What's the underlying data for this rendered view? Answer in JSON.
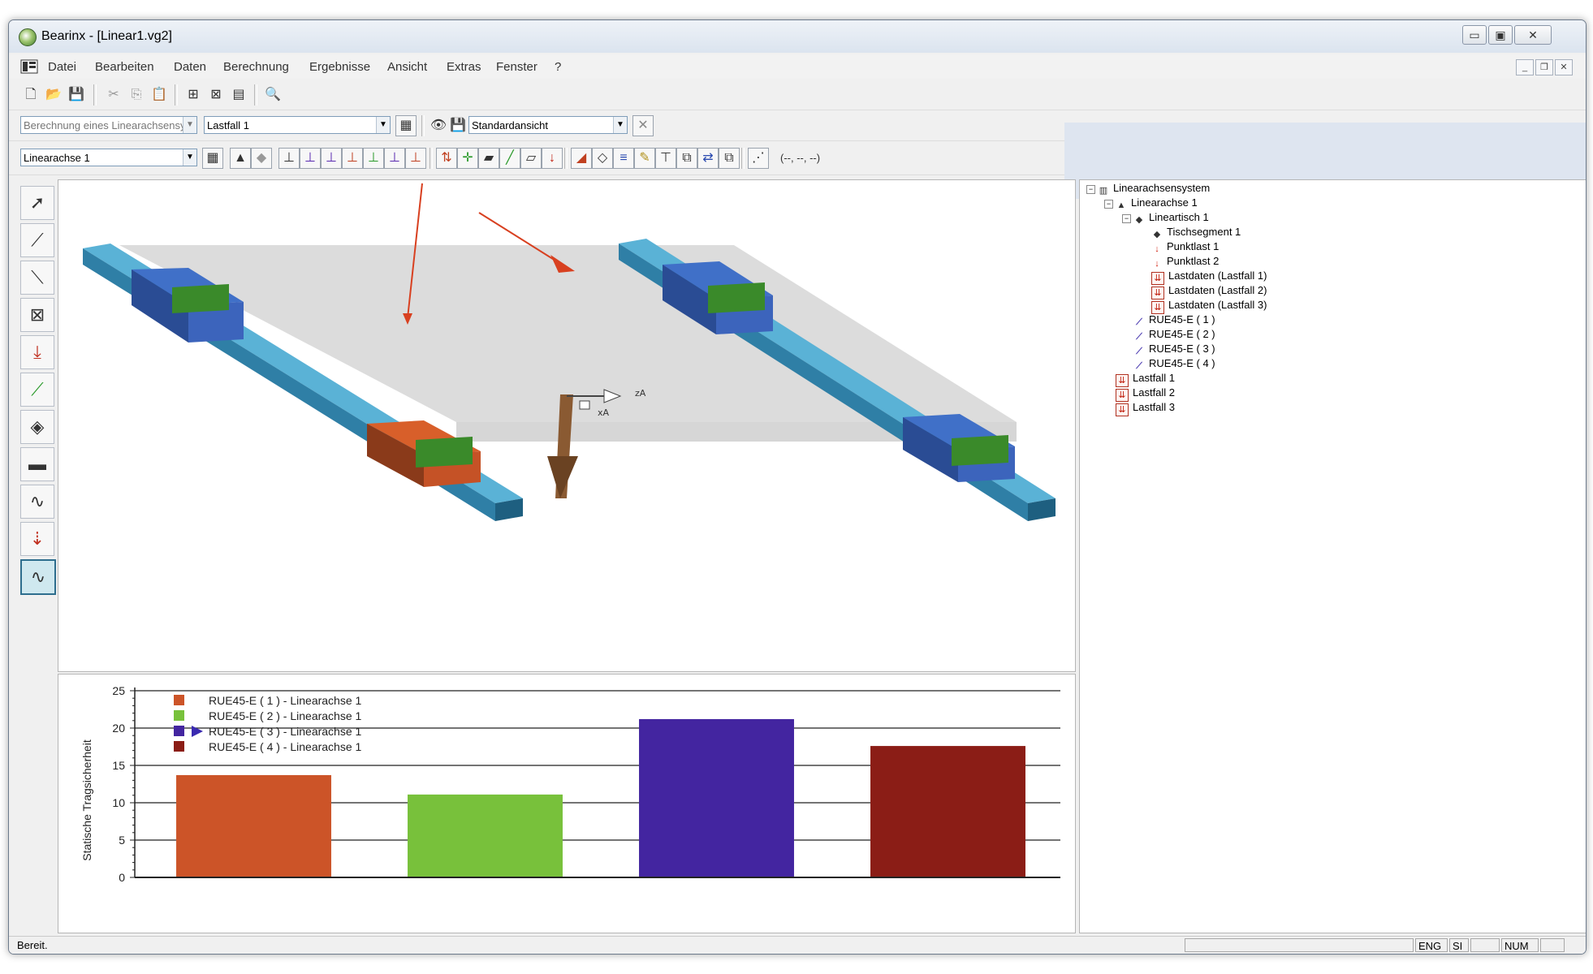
{
  "window": {
    "title": "Bearinx - [Linear1.vg2]"
  },
  "menu": [
    "Datei",
    "Bearbeiten",
    "Daten",
    "Berechnung",
    "Ergebnisse",
    "Ansicht",
    "Extras",
    "Fenster",
    "?"
  ],
  "toolbar2": {
    "calc_type": "Berechnung eines Linearachsensyste",
    "loadcase": "Lastfall 1",
    "view": "Standardansicht"
  },
  "toolbar3": {
    "axis": "Linearachse 1",
    "coords": "(--, --, --)"
  },
  "view3d": {
    "axis_labels": {
      "z": "zA",
      "x": "xA"
    }
  },
  "tree": {
    "root": "Linearachsensystem",
    "axis": "Linearachse 1",
    "table": "Lineartisch 1",
    "table_children": [
      "Tischsegment 1",
      "Punktlast 1",
      "Punktlast 2",
      "Lastdaten (Lastfall 1)",
      "Lastdaten (Lastfall 2)",
      "Lastdaten (Lastfall 3)"
    ],
    "bearings": [
      "RUE45-E ( 1 )",
      "RUE45-E ( 2 )",
      "RUE45-E ( 3 )",
      "RUE45-E ( 4 )"
    ],
    "loadcases": [
      "Lastfall 1",
      "Lastfall 2",
      "Lastfall 3"
    ]
  },
  "chart_data": {
    "type": "bar",
    "ylabel": "Statische Tragsicherheit",
    "ylim": [
      0,
      25
    ],
    "yticks": [
      0,
      5,
      10,
      15,
      20,
      25
    ],
    "grid": true,
    "legend_position": "top-left",
    "legend_marker_index": 2,
    "series": [
      {
        "name": "RUE45-E ( 1 ) - Linearachse 1",
        "value": 13.7,
        "color": "#cc5428"
      },
      {
        "name": "RUE45-E ( 2 ) - Linearachse 1",
        "value": 11.1,
        "color": "#78c13b"
      },
      {
        "name": "RUE45-E ( 3 ) - Linearachse 1",
        "value": 21.2,
        "color": "#4325a0"
      },
      {
        "name": "RUE45-E ( 4 ) - Linearachse 1",
        "value": 17.6,
        "color": "#8b1d16"
      }
    ]
  },
  "status": {
    "text": "Bereit.",
    "lang": "ENG",
    "units": "SI",
    "num": "NUM"
  }
}
